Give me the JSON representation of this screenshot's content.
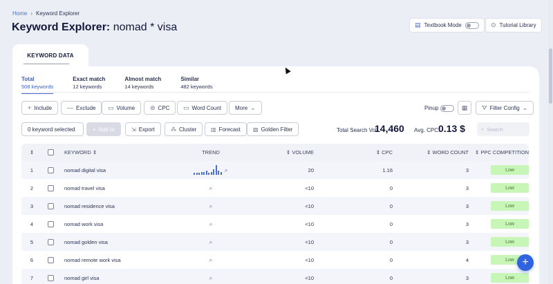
{
  "breadcrumb": {
    "home": "Home",
    "separator": "›",
    "current": "Keyword Explorer"
  },
  "title": {
    "prefix": "Keyword Explorer:",
    "query": "nomad * visa"
  },
  "top_buttons": {
    "textbook_mode": "Textbook Mode",
    "tutorial_library": "Tutorial Library"
  },
  "section_tab": "KEYWORD DATA",
  "filter_tabs": [
    {
      "label": "Total",
      "count": "508 keywords",
      "active": true
    },
    {
      "label": "Exact match",
      "count": "12 keywords"
    },
    {
      "label": "Almost match",
      "count": "14 keywords"
    },
    {
      "label": "Similar",
      "count": "482 keywords"
    }
  ],
  "filters": {
    "include": "Include",
    "exclude": "Exclude",
    "volume": "Volume",
    "cpc": "CPC",
    "word_count": "Word Count",
    "more": "More",
    "pinup": "Pinup",
    "filter_config": "Filter Config"
  },
  "actions": {
    "selected": "0 keyword selected",
    "add_to": "Add to",
    "export": "Export",
    "cluster": "Cluster",
    "forecast": "Forecast",
    "golden_filter": "Golden Filter"
  },
  "stats": {
    "total_vol_label": "Total Search Vol:",
    "total_vol": "14,460",
    "avg_cpc_label": "Avg. CPC:",
    "avg_cpc": "0.13 $"
  },
  "search": {
    "placeholder": "Search"
  },
  "table": {
    "headers": {
      "keyword": "KEYWORD",
      "trend": "TREND",
      "volume": "VOLUME",
      "cpc": "CPC",
      "word_count": "WORD COUNT",
      "ppc": "PPC COMPETITION"
    },
    "rows": [
      {
        "n": "1",
        "keyword": "nomad digital visa",
        "volume": "20",
        "cpc": "1.16",
        "wc": "3",
        "ppc": "Low",
        "trend": [
          2,
          2,
          2,
          3,
          3,
          4,
          2,
          3,
          6,
          10,
          4,
          3
        ]
      },
      {
        "n": "2",
        "keyword": "nomad travel visa",
        "volume": "<10",
        "cpc": "0",
        "wc": "3",
        "ppc": "Low"
      },
      {
        "n": "3",
        "keyword": "nomad residence visa",
        "volume": "<10",
        "cpc": "0",
        "wc": "3",
        "ppc": "Low"
      },
      {
        "n": "4",
        "keyword": "nomad work visa",
        "volume": "<10",
        "cpc": "0",
        "wc": "3",
        "ppc": "Low"
      },
      {
        "n": "5",
        "keyword": "nomad golden visa",
        "volume": "<10",
        "cpc": "0",
        "wc": "3",
        "ppc": "Low"
      },
      {
        "n": "6",
        "keyword": "nomad remote work visa",
        "volume": "<10",
        "cpc": "0",
        "wc": "4",
        "ppc": "Low"
      },
      {
        "n": "7",
        "keyword": "nomad girl visa",
        "volume": "<10",
        "cpc": "0",
        "wc": "3",
        "ppc": "Low"
      }
    ]
  },
  "colors": {
    "accent": "#3c5fc4",
    "fab": "#2f63e0",
    "badge_bg": "#c8f5b8",
    "badge_text": "#3f7a2a"
  }
}
